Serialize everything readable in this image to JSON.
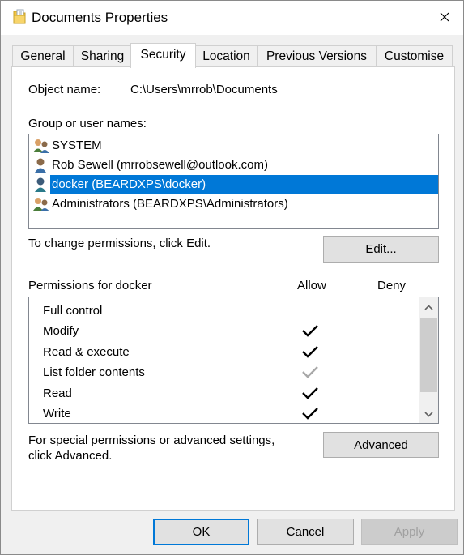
{
  "window": {
    "title": "Documents Properties",
    "close": "✕"
  },
  "tabs": [
    "General",
    "Sharing",
    "Security",
    "Location",
    "Previous Versions",
    "Customise"
  ],
  "active_tab": "Security",
  "object": {
    "label": "Object name:",
    "value": "C:\\Users\\mrrob\\Documents"
  },
  "groups": {
    "label": "Group or user names:",
    "items": [
      {
        "name": "SYSTEM",
        "icon": "group-icon"
      },
      {
        "name": "Rob Sewell (mrrobsewell@outlook.com)",
        "icon": "user-icon"
      },
      {
        "name": "docker (BEARDXPS\\docker)",
        "icon": "user-icon",
        "selected": true
      },
      {
        "name": "Administrators (BEARDXPS\\Administrators)",
        "icon": "group-icon"
      }
    ]
  },
  "change_text": "To change permissions, click Edit.",
  "edit_button": "Edit...",
  "permissions": {
    "label": "Permissions for docker",
    "allow_header": "Allow",
    "deny_header": "Deny",
    "rows": [
      {
        "name": "Full control",
        "allow": "none"
      },
      {
        "name": "Modify",
        "allow": "checked"
      },
      {
        "name": "Read & execute",
        "allow": "checked"
      },
      {
        "name": "List folder contents",
        "allow": "inherited"
      },
      {
        "name": "Read",
        "allow": "checked"
      },
      {
        "name": "Write",
        "allow": "checked"
      }
    ]
  },
  "special": {
    "line1": "For special permissions or advanced settings,",
    "line2": "click Advanced."
  },
  "advanced_button": "Advanced",
  "footer": {
    "ok": "OK",
    "cancel": "Cancel",
    "apply": "Apply"
  },
  "colors": {
    "selection": "#0078d7",
    "focus_border": "#0078d7",
    "check": "#000000",
    "check_inherited": "#a8a8a8"
  }
}
